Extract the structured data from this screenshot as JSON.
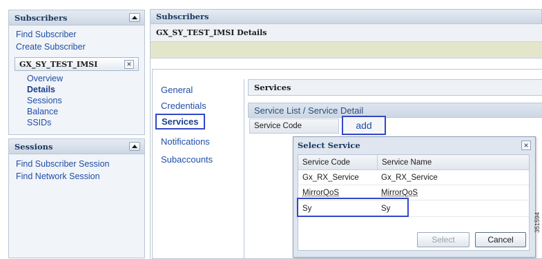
{
  "sidebar": {
    "subscribers_panel": {
      "title": "Subscribers",
      "links": [
        "Find Subscriber",
        "Create Subscriber"
      ],
      "subscriber_chip": "GX_SY_TEST_IMSI",
      "sub_links": [
        {
          "label": "Overview",
          "active": false
        },
        {
          "label": "Details",
          "active": true
        },
        {
          "label": "Sessions",
          "active": false
        },
        {
          "label": "Balance",
          "active": false
        },
        {
          "label": "SSIDs",
          "active": false
        }
      ]
    },
    "sessions_panel": {
      "title": "Sessions",
      "links": [
        "Find Subscriber Session",
        "Find Network Session"
      ]
    }
  },
  "main": {
    "header_title": "Subscribers",
    "detail_title": "GX_SY_TEST_IMSI Details",
    "nav": [
      {
        "label": "General",
        "selected": false
      },
      {
        "label": "Credentials",
        "selected": false
      },
      {
        "label": "Services",
        "selected": true
      },
      {
        "label": "Notifications",
        "selected": false
      },
      {
        "label": "Subaccounts",
        "selected": false
      }
    ],
    "services_header": "Services",
    "service_list_title": "Service List / Service Detail",
    "service_code_column": "Service Code",
    "add_button": "add"
  },
  "dialog": {
    "title": "Select Service",
    "columns": [
      "Service Code",
      "Service Name"
    ],
    "rows": [
      {
        "code": "Gx_RX_Service",
        "name": "Gx_RX_Service"
      },
      {
        "code": "MirrorQoS",
        "name": "MirrorQoS"
      },
      {
        "code": "Sy",
        "name": "Sy"
      }
    ],
    "highlighted_row": "Sy",
    "select_button": "Select",
    "select_enabled": false,
    "cancel_button": "Cancel"
  },
  "figure_id": "351594",
  "colors": {
    "link": "#1f4ea8",
    "header_text": "#17375e",
    "highlight_border": "#3346c6",
    "info_bar": "#e4e6cb"
  }
}
